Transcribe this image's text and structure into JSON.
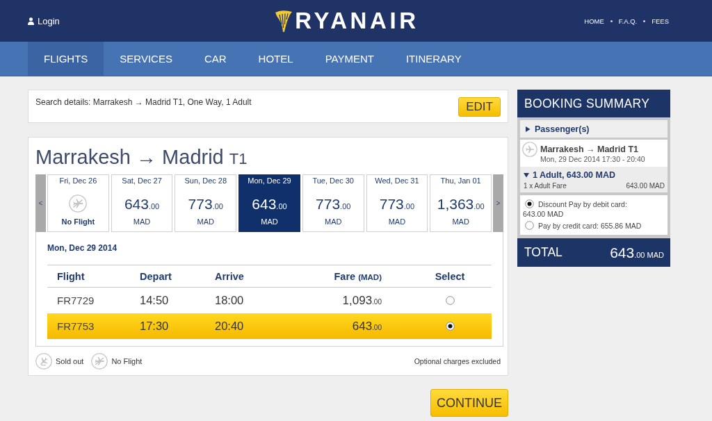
{
  "header": {
    "login": "Login",
    "logo": "RYANAIR",
    "links": [
      "HOME",
      "F.A.Q.",
      "FEES"
    ]
  },
  "nav": [
    {
      "label": "FLIGHTS",
      "selected": true
    },
    {
      "label": "SERVICES",
      "selected": false
    },
    {
      "label": "CAR",
      "selected": false
    },
    {
      "label": "HOTEL",
      "selected": false
    },
    {
      "label": "PAYMENT",
      "selected": false
    },
    {
      "label": "ITINERARY",
      "selected": false
    }
  ],
  "search_details": {
    "text": "Search details: Marrakesh → Madrid T1, One Way, 1 Adult",
    "edit_button": "EDIT"
  },
  "flight_card": {
    "route": "Marrakesh → Madrid",
    "terminal": "T1",
    "prev_arrow": "<",
    "next_arrow": ">",
    "dates": [
      {
        "day": "Fri, Dec 26",
        "kind": "no_flight",
        "label": "No Flight",
        "selected": false
      },
      {
        "day": "Sat, Dec 27",
        "kind": "fare",
        "amount": "643",
        "decimals": ".00",
        "currency": "MAD",
        "selected": false
      },
      {
        "day": "Sun, Dec 28",
        "kind": "fare",
        "amount": "773",
        "decimals": ".00",
        "currency": "MAD",
        "selected": false
      },
      {
        "day": "Mon, Dec 29",
        "kind": "fare",
        "amount": "643",
        "decimals": ".00",
        "currency": "MAD",
        "selected": true
      },
      {
        "day": "Tue, Dec 30",
        "kind": "fare",
        "amount": "773",
        "decimals": ".00",
        "currency": "MAD",
        "selected": false
      },
      {
        "day": "Wed, Dec 31",
        "kind": "fare",
        "amount": "773",
        "decimals": ".00",
        "currency": "MAD",
        "selected": false
      },
      {
        "day": "Thu, Jan 01",
        "kind": "fare",
        "amount": "1,363",
        "decimals": ".00",
        "currency": "MAD",
        "selected": false
      }
    ],
    "selected_date": "Mon, Dec 29 2014",
    "table": {
      "columns": [
        {
          "label": "Flight"
        },
        {
          "label": "Depart"
        },
        {
          "label": "Arrive"
        },
        {
          "label": "Fare",
          "unit": "(MAD)"
        },
        {
          "label": "Select"
        }
      ],
      "rows": [
        {
          "flight": "FR7729",
          "depart": "14:50",
          "arrive": "18:00",
          "fare": "1,093",
          "decimals": ".00",
          "selected": false
        },
        {
          "flight": "FR7753",
          "depart": "17:30",
          "arrive": "20:40",
          "fare": "643",
          "decimals": ".00",
          "selected": true
        }
      ]
    },
    "legend": [
      {
        "kind": "sold_out",
        "label": "Sold out"
      },
      {
        "kind": "no_flight",
        "label": "No Flight"
      }
    ],
    "note": "Optional charges excluded"
  },
  "continue_button": "CONTINUE",
  "booking_summary": {
    "title": "BOOKING SUMMARY",
    "passengers": {
      "label": "Passenger(s)",
      "expanded": false
    },
    "flight": {
      "route": "Marrakesh → Madrid T1",
      "time": "Mon, 29 Dec 2014 17:30 - 20:40"
    },
    "fare_group": {
      "label": "1 Adult, 643.00 MAD",
      "expanded": true,
      "lines": [
        {
          "label": "1 x Adult Fare",
          "amount": "643.00 MAD"
        }
      ]
    },
    "payment_options": [
      {
        "label": "Discount Pay by debit card:",
        "amount": "643.00 MAD",
        "selected": true
      },
      {
        "label": "Pay by credit card:",
        "amount": "655.86 MAD",
        "selected": false
      }
    ],
    "total": {
      "label": "TOTAL",
      "amount": "643",
      "decimals": ".00",
      "currency": "MAD"
    }
  }
}
